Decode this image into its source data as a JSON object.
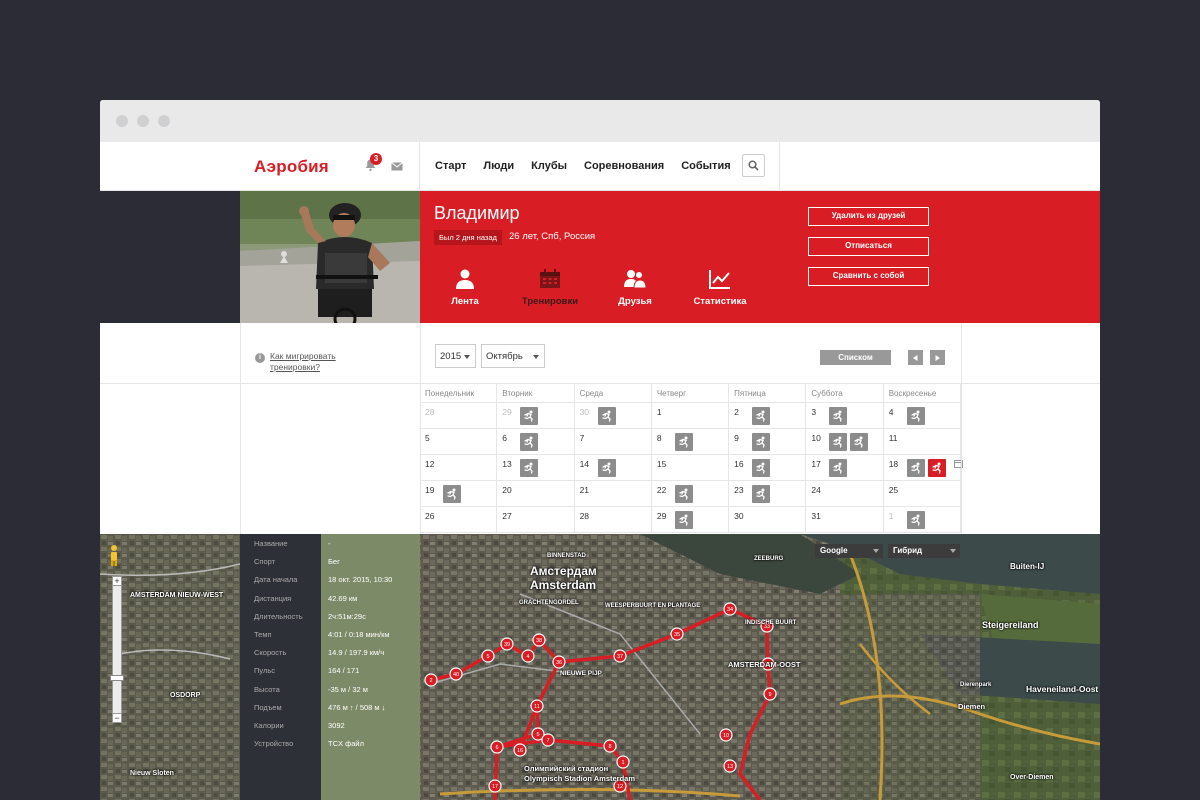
{
  "brand": {
    "name": "Аэробия",
    "accent": "#d81e24",
    "notifications_count": "3"
  },
  "nav": {
    "items": [
      "Старт",
      "Люди",
      "Клубы",
      "Соревнования",
      "События"
    ]
  },
  "profile": {
    "name": "Владимир",
    "last_seen": "Был 2 дня назад",
    "info": "26 лет, Спб, Россия",
    "tabs": [
      {
        "label": "Лента",
        "icon": "user-icon"
      },
      {
        "label": "Тренировки",
        "icon": "calendar-icon",
        "active": true
      },
      {
        "label": "Друзья",
        "icon": "friends-icon"
      },
      {
        "label": "Статистика",
        "icon": "chart-icon"
      }
    ],
    "actions": [
      "Удалить из друзей",
      "Отписаться",
      "Сравнить с собой"
    ]
  },
  "controls": {
    "migrate_link": "Как мигрировать тренировки?",
    "year": "2015",
    "month": "Октябрь",
    "list_button": "Списком"
  },
  "calendar": {
    "weekdays": [
      "Понедельник",
      "Вторник",
      "Среда",
      "Четверг",
      "Пятница",
      "Суббота",
      "Воскресенье"
    ],
    "weeks": [
      [
        {
          "d": "28",
          "dim": true
        },
        {
          "d": "29",
          "dim": true,
          "acts": 1
        },
        {
          "d": "30",
          "dim": true,
          "acts": 1
        },
        {
          "d": "1"
        },
        {
          "d": "2",
          "acts": 1
        },
        {
          "d": "3",
          "acts": 1
        },
        {
          "d": "4",
          "acts": 1
        }
      ],
      [
        {
          "d": "5"
        },
        {
          "d": "6",
          "acts": 1
        },
        {
          "d": "7"
        },
        {
          "d": "8",
          "acts": 1
        },
        {
          "d": "9",
          "acts": 1
        },
        {
          "d": "10",
          "acts": 2
        },
        {
          "d": "11"
        }
      ],
      [
        {
          "d": "12"
        },
        {
          "d": "13",
          "acts": 1
        },
        {
          "d": "14",
          "acts": 1
        },
        {
          "d": "15"
        },
        {
          "d": "16",
          "acts": 1
        },
        {
          "d": "17",
          "acts": 1
        },
        {
          "d": "18",
          "acts": 2,
          "red": true,
          "cal": true
        }
      ],
      [
        {
          "d": "19",
          "acts": 1
        },
        {
          "d": "20"
        },
        {
          "d": "21"
        },
        {
          "d": "22",
          "acts": 1
        },
        {
          "d": "23",
          "acts": 1
        },
        {
          "d": "24"
        },
        {
          "d": "25"
        }
      ],
      [
        {
          "d": "26"
        },
        {
          "d": "27"
        },
        {
          "d": "28"
        },
        {
          "d": "29",
          "acts": 1
        },
        {
          "d": "30"
        },
        {
          "d": "31"
        },
        {
          "d": "1",
          "dim": true,
          "acts": 1
        }
      ]
    ]
  },
  "workout": {
    "rows": [
      {
        "k": "Название",
        "v": "-"
      },
      {
        "k": "Спорт",
        "v": "Бег"
      },
      {
        "k": "Дата начала",
        "v": "18 окт. 2015, 10:30"
      },
      {
        "k": "Дистанция",
        "v": "42.69 км"
      },
      {
        "k": "Длительность",
        "v": "2ч:51м:29с"
      },
      {
        "k": "Темп",
        "v": "4:01 / 0:18 мин/км"
      },
      {
        "k": "Скорость",
        "v": "14.9 / 197.9 км/ч"
      },
      {
        "k": "Пульс",
        "v": "164 / 171"
      },
      {
        "k": "Высота",
        "v": "-35 м / 32 м"
      },
      {
        "k": "Подъем",
        "v": "476 м ↑ / 508 м ↓"
      },
      {
        "k": "Калории",
        "v": "3092"
      },
      {
        "k": "Устройство",
        "v": "TCX файл"
      }
    ]
  },
  "map": {
    "provider": "Google",
    "mode": "Гибрид",
    "labels": [
      "Амстердам",
      "Amsterdam",
      "AMSTERDAM NIEUW-WEST",
      "Steigereiland",
      "Haveneiland-Oost",
      "AMSTERDAM-OOST",
      "Diemen",
      "Олимпийский стадион",
      "Olympisch Stadion Amsterdam",
      "NIEUWE PIJP",
      "WEESPERBUURT EN PLANTAGE",
      "INDISCHE BUURT",
      "Buiten-IJ",
      "Dierenpark",
      "BINNENSTAD",
      "GRACHTENGORDEL",
      "ZEEBURG",
      "Nieuw Sloten",
      "OSDORP",
      "Over-Diemen"
    ],
    "markers": [
      "2",
      "40",
      "5",
      "39",
      "4",
      "38",
      "36",
      "37",
      "35",
      "34",
      "33",
      "32",
      "9",
      "10",
      "11",
      "5",
      "6",
      "7",
      "8",
      "1",
      "16",
      "17",
      "12",
      "13"
    ]
  }
}
